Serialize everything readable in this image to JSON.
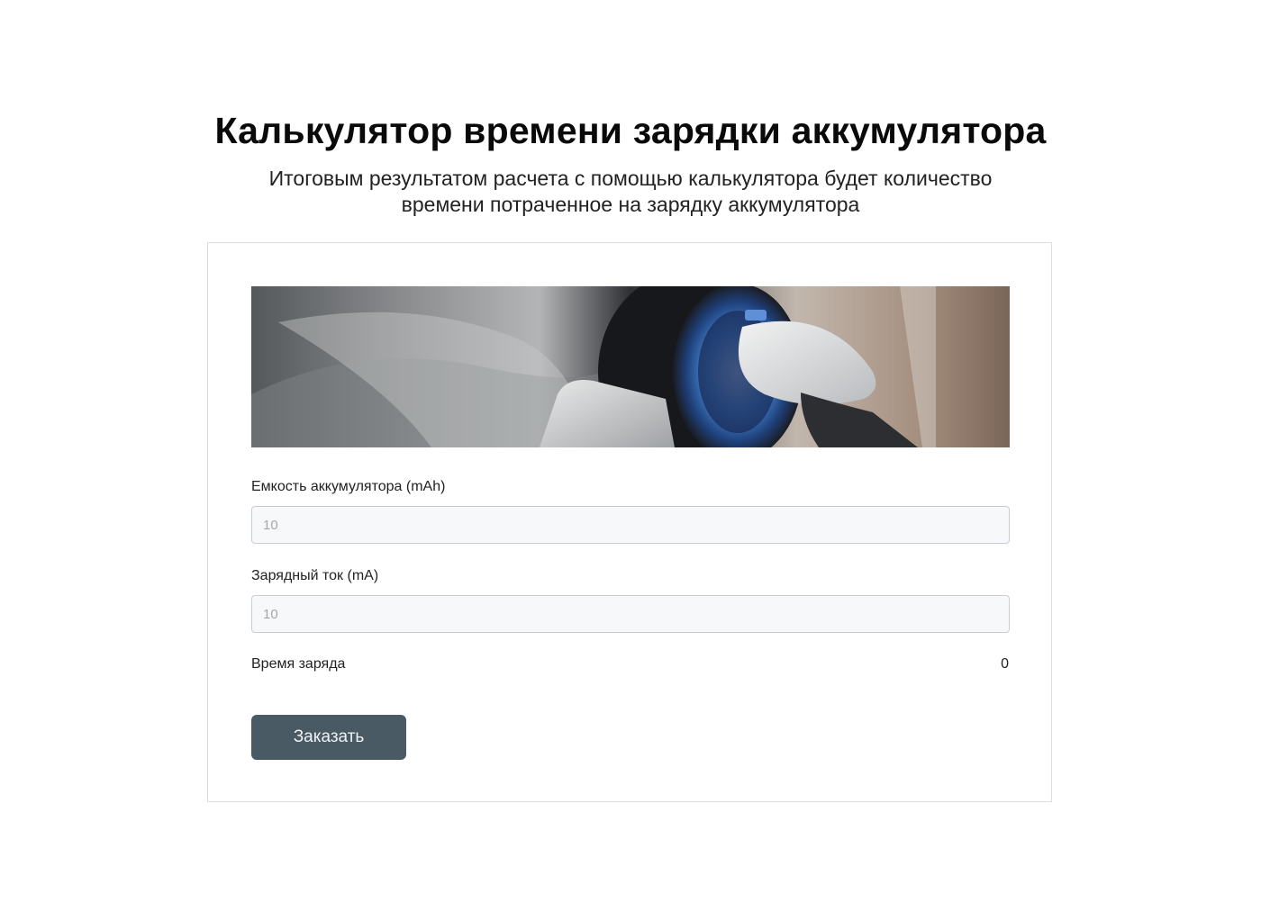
{
  "header": {
    "title": "Калькулятор времени зарядки аккумулятора",
    "subtitle": "Итоговым результатом расчета с помощью калькулятора будет количество времени потраченное на зарядку аккумулятора"
  },
  "calculator": {
    "capacity_label": "Емкость аккумулятора (mAh)",
    "capacity_placeholder": "10",
    "capacity_value": "",
    "current_label": "Зарядный ток (mA)",
    "current_placeholder": "10",
    "current_value": "",
    "result_label": "Время заряда",
    "result_value": "0",
    "order_button_label": "Заказать"
  },
  "colors": {
    "button_background": "#4a5a65",
    "input_background": "#f7f8fa",
    "card_border": "#dcdcdc"
  }
}
